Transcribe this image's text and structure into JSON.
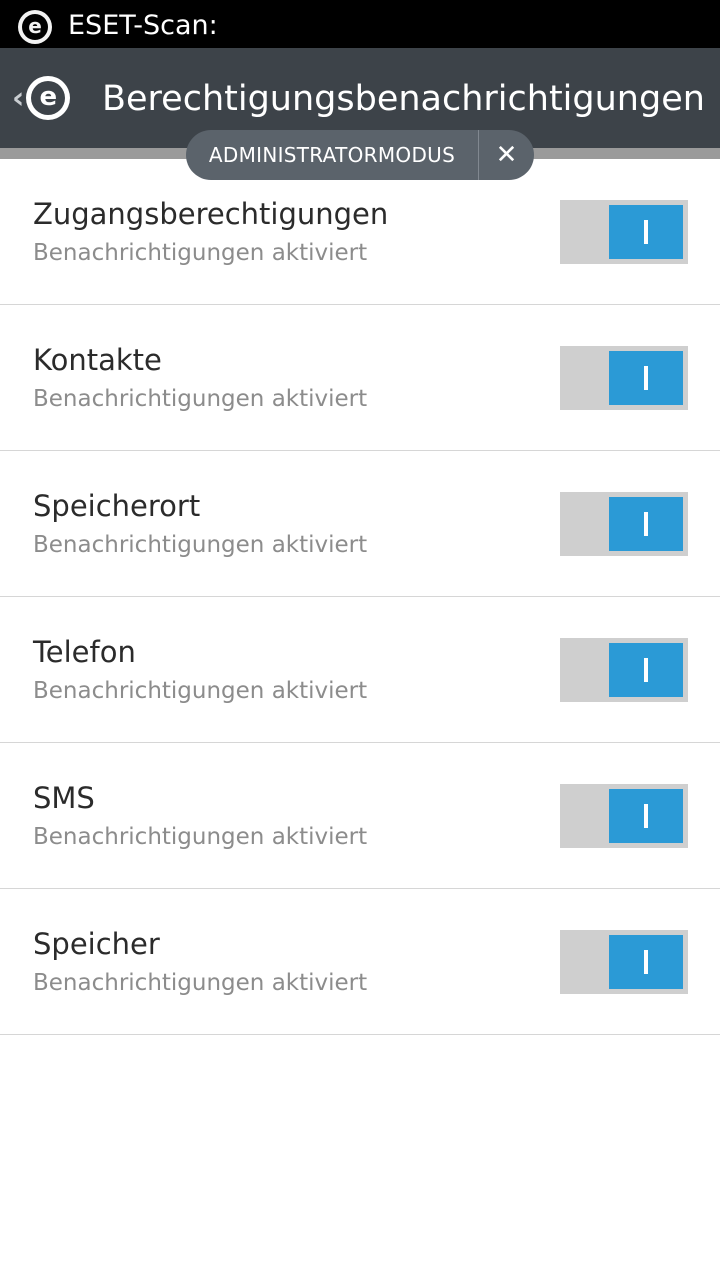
{
  "status_bar": {
    "notification_title": "ESET-Scan:",
    "icon": "eset-logo-icon"
  },
  "action_bar": {
    "back_icon": "chevron-left-icon",
    "logo_icon": "eset-logo-icon",
    "title": "Berechtigungsbenachrichtigungen",
    "background_color": "#3d4349"
  },
  "admin_mode": {
    "label": "ADMINISTRATORMODUS",
    "close_icon": "close-icon",
    "close_symbol": "✕"
  },
  "permissions": [
    {
      "title": "Zugangsberechtigungen",
      "subtitle": "Benachrichtigungen aktiviert",
      "enabled": true
    },
    {
      "title": "Kontakte",
      "subtitle": "Benachrichtigungen aktiviert",
      "enabled": true
    },
    {
      "title": "Speicherort",
      "subtitle": "Benachrichtigungen aktiviert",
      "enabled": true
    },
    {
      "title": "Telefon",
      "subtitle": "Benachrichtigungen aktiviert",
      "enabled": true
    },
    {
      "title": "SMS",
      "subtitle": "Benachrichtigungen aktiviert",
      "enabled": true
    },
    {
      "title": "Speicher",
      "subtitle": "Benachrichtigungen aktiviert",
      "enabled": true
    }
  ],
  "colors": {
    "toggle_on": "#2b9ad6",
    "toggle_track": "#cfcfcf"
  }
}
